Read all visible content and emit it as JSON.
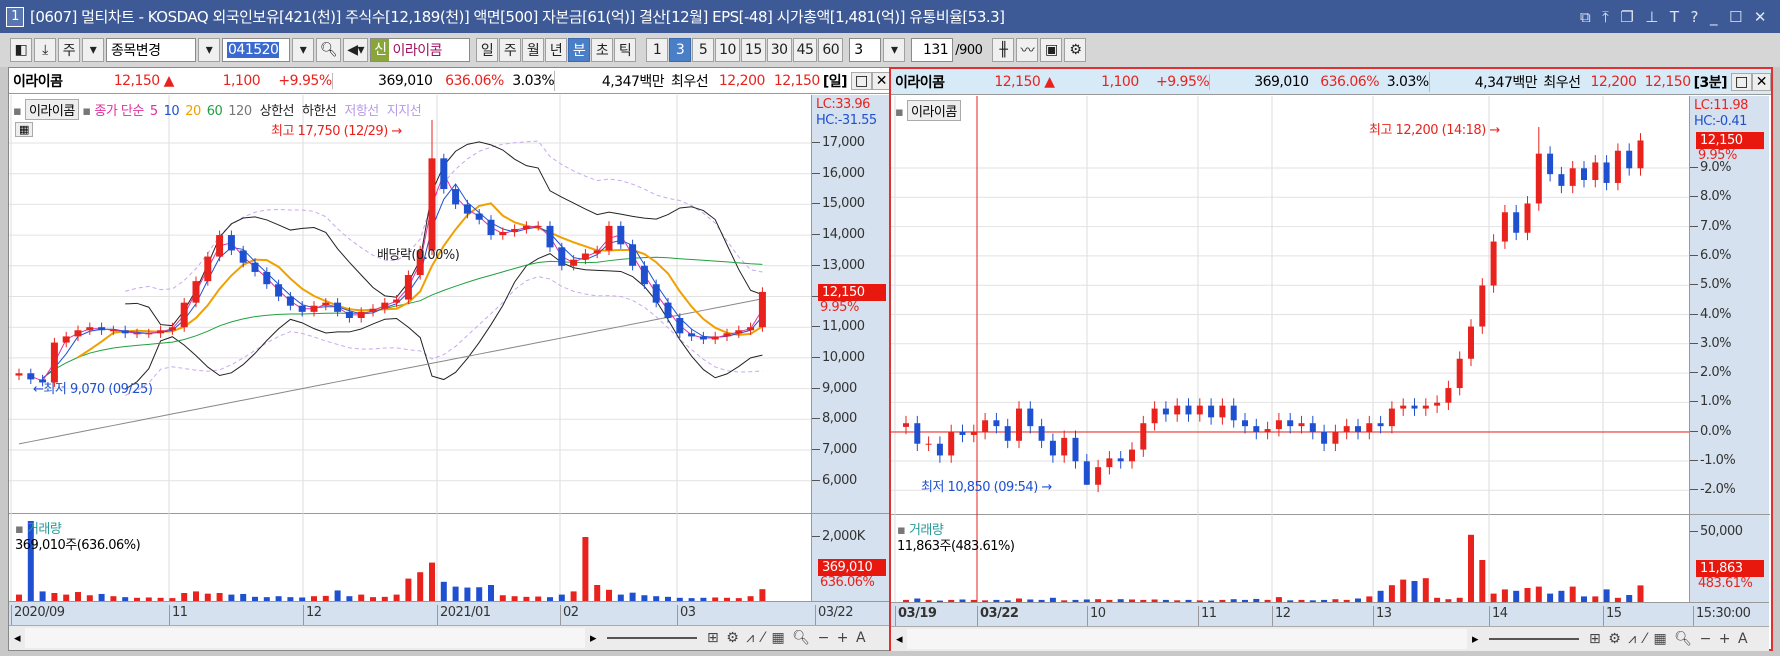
{
  "window": {
    "num": "1",
    "title": "[0607] 멀티차트 - KOSDAQ 외국인보유[421(천)] 주식수[12,189(천)] 액면[500] 자본금[61(억)] 결산[12월] EPS[-48] 시가총액[1,481(억)] 유통비율[53.3]",
    "icons": [
      "restore-icon",
      "pin-top-icon",
      "copy-icon",
      "pin-icon",
      "T",
      "?",
      "_",
      "☐",
      "✕"
    ]
  },
  "toolbar": {
    "market": "주",
    "change": "종목변경",
    "code": "041520",
    "badge": "신",
    "stock": "이라이콤",
    "periods": [
      "일",
      "주",
      "월",
      "년",
      "분",
      "초",
      "틱"
    ],
    "active_period": "분",
    "intervals": [
      "1",
      "3",
      "5",
      "10",
      "15",
      "30",
      "45",
      "60"
    ],
    "active_interval": "3",
    "count_combo": "3",
    "count": "131",
    "count_max": "/900"
  },
  "colors": {
    "up": "#e8231e",
    "down": "#1e50d0",
    "accent": "#3d5a96"
  },
  "left": {
    "info": {
      "name": "이라이콤",
      "price": "12,150 ▲",
      "change": "1,100",
      "rate": "+9.95%",
      "volume": "369,010",
      "vol_rate": "636.06%",
      "turnover": "3.03%",
      "amount": "4,347백만",
      "best_label": "최우선",
      "ask": "12,200",
      "bid": "12,150",
      "period": "[일]"
    },
    "legend": {
      "name": "이라이콤",
      "ma_label": "종가 단순",
      "mas": [
        "5",
        "10",
        "20",
        "60",
        "120"
      ],
      "upper": "상한선",
      "lower": "하한선",
      "resist": "저항선",
      "support": "지지선"
    },
    "lc": "LC:33.96",
    "hc": "HC:-31.55",
    "y_ticks": [
      "17,000",
      "16,000",
      "15,000",
      "14,000",
      "13,000",
      "12,000",
      "11,000",
      "10,000",
      "9,000",
      "8,000",
      "7,000",
      "6,000"
    ],
    "price_tag": "12,150",
    "rate_tag": "9.95%",
    "high_note": "최고 17,750 (12/29) →",
    "low_note": "←최저 9,070 (09/25)",
    "ex_div": "배당락(0.00%)",
    "vol_legend": "거래량",
    "vol_text": "369,010주(636.06%)",
    "vol_tick": "2,000K",
    "vol_tag": "369,010",
    "vol_rate_tag": "636.06%",
    "x_labels": [
      "2020/09",
      "11",
      "12",
      "2021/01",
      "02",
      "03",
      "03/22"
    ]
  },
  "right": {
    "info": {
      "name": "이라이콤",
      "price": "12,150 ▲",
      "change": "1,100",
      "rate": "+9.95%",
      "volume": "369,010",
      "vol_rate": "636.06%",
      "turnover": "3.03%",
      "amount": "4,347백만",
      "best_label": "최우선",
      "ask": "12,200",
      "bid": "12,150",
      "period": "[3분]"
    },
    "legend": {
      "name": "이라이콤"
    },
    "lc": "LC:11.98",
    "hc": "HC:-0.41",
    "y_ticks": [
      "9.0%",
      "8.0%",
      "7.0%",
      "6.0%",
      "5.0%",
      "4.0%",
      "3.0%",
      "2.0%",
      "1.0%",
      "0.0%",
      "-1.0%",
      "-2.0%"
    ],
    "price_tag": "12,150",
    "rate_tag": "9.95%",
    "high_note": "최고 12,200 (14:18) →",
    "low_note": "최저 10,850 (09:54) →",
    "vol_legend": "거래량",
    "vol_text": "11,863주(483.61%)",
    "vol_tick": "50,000",
    "vol_tag": "11,863",
    "vol_rate_tag": "483.61%",
    "x_labels": [
      "03/19",
      "03/22",
      "10",
      "11",
      "12",
      "13",
      "14",
      "15",
      "15:30:00"
    ]
  },
  "chart_data": [
    {
      "type": "candlestick",
      "name": "daily",
      "y_unit": "KRW",
      "ylim": [
        6000,
        17500
      ],
      "high": 17750,
      "high_date": "12/29",
      "low": 9070,
      "low_date": "09/25",
      "closes": [
        9500,
        9300,
        9200,
        10500,
        10700,
        10900,
        11000,
        10900,
        10900,
        10800,
        10800,
        10800,
        10900,
        11000,
        11800,
        12500,
        13300,
        14000,
        13500,
        13100,
        12800,
        12400,
        12000,
        11700,
        11500,
        11700,
        11800,
        11500,
        11300,
        11500,
        11600,
        11800,
        11900,
        12700,
        13500,
        16500,
        15500,
        15000,
        14700,
        14500,
        14000,
        14100,
        14200,
        14300,
        14300,
        13600,
        13000,
        13200,
        13400,
        13500,
        14300,
        13700,
        13000,
        12400,
        11800,
        11300,
        10800,
        10700,
        10600,
        10700,
        10800,
        10900,
        11000,
        12150
      ],
      "volume_k": [
        200,
        2500,
        300,
        250,
        200,
        280,
        180,
        220,
        150,
        120,
        100,
        110,
        100,
        90,
        250,
        300,
        230,
        250,
        200,
        220,
        130,
        120,
        150,
        120,
        110,
        150,
        160,
        330,
        150,
        200,
        120,
        130,
        200,
        700,
        900,
        1200,
        600,
        450,
        420,
        430,
        500,
        180,
        150,
        130,
        140,
        120,
        200,
        300,
        2000,
        500,
        350,
        200,
        260,
        180,
        150,
        130,
        100,
        90,
        100,
        110,
        100,
        90,
        150,
        369
      ]
    },
    {
      "type": "candlestick",
      "name": "3min",
      "y_unit": "% change",
      "ylim": [
        -2.5,
        10.5
      ],
      "high": 12200,
      "high_time": "14:18",
      "low": 10850,
      "low_time": "09:54",
      "closes": [
        0.3,
        -0.4,
        -0.4,
        -0.8,
        0.0,
        -0.1,
        0.0,
        0.4,
        0.2,
        -0.3,
        0.8,
        0.2,
        -0.3,
        -0.8,
        -0.2,
        -1.0,
        -1.8,
        -1.2,
        -0.9,
        -1.0,
        -0.6,
        0.3,
        0.8,
        0.6,
        0.9,
        0.6,
        0.9,
        0.5,
        0.9,
        0.4,
        0.2,
        0.0,
        0.1,
        0.4,
        0.2,
        0.3,
        0.0,
        -0.4,
        0.0,
        0.2,
        0.0,
        0.3,
        0.2,
        0.8,
        0.9,
        0.8,
        0.9,
        1.0,
        1.5,
        2.5,
        3.6,
        5.0,
        6.5,
        7.5,
        6.8,
        7.8,
        9.5,
        8.8,
        8.4,
        9.0,
        8.6,
        9.2,
        8.5,
        9.6,
        9.0,
        9.95
      ],
      "volume": [
        1500,
        2500,
        1500,
        1000,
        1500,
        1800,
        1500,
        1200,
        1500,
        1200,
        2500,
        1800,
        1500,
        3000,
        1200,
        1500,
        1800,
        2000,
        1500,
        2000,
        1800,
        1500,
        1800,
        1500,
        1200,
        1500,
        1200,
        1000,
        1500,
        2000,
        1500,
        2200,
        1500,
        3500,
        1200,
        1500,
        1200,
        1500,
        2000,
        1500,
        2500,
        4000,
        8000,
        12000,
        16000,
        15000,
        17000,
        3000,
        2000,
        3000,
        48000,
        30000,
        6000,
        9000,
        8000,
        10000,
        11000,
        6000,
        8000,
        11000,
        4000,
        4000,
        9000,
        3000,
        5000,
        11863
      ]
    }
  ]
}
